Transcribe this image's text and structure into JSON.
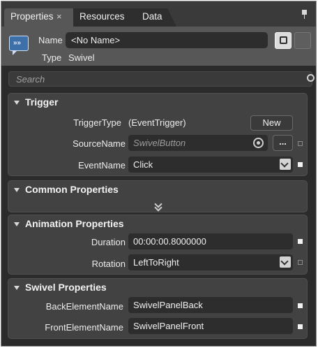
{
  "tabs": [
    {
      "label": "Properties",
      "close": "×"
    },
    {
      "label": "Resources"
    },
    {
      "label": "Data"
    }
  ],
  "header": {
    "name_label": "Name",
    "name_value": "<No Name>",
    "type_label": "Type",
    "type_value": "Swivel"
  },
  "search": {
    "placeholder": "Search"
  },
  "trigger": {
    "title": "Trigger",
    "trigger_type_label": "TriggerType",
    "trigger_type_value": "(EventTrigger)",
    "new_button": "New",
    "source_name_label": "SourceName",
    "source_name_value": "SwivelButton",
    "ellipsis_button": "...",
    "event_name_label": "EventName",
    "event_name_value": "Click"
  },
  "common": {
    "title": "Common Properties"
  },
  "animation": {
    "title": "Animation Properties",
    "duration_label": "Duration",
    "duration_value": "00:00:00.8000000",
    "rotation_label": "Rotation",
    "rotation_value": "LeftToRight"
  },
  "swivel": {
    "title": "Swivel Properties",
    "back_label": "BackElementName",
    "back_value": "SwivelPanelBack",
    "front_label": "FrontElementName",
    "front_value": "SwivelPanelFront"
  },
  "icons": [
    "pin-icon",
    "object-icon",
    "properties-view-icon",
    "events-view-icon",
    "search-icon",
    "collapse-triangle-icon",
    "target-picker-icon",
    "dropdown-chevron-icon",
    "expand-chevron-icon"
  ]
}
